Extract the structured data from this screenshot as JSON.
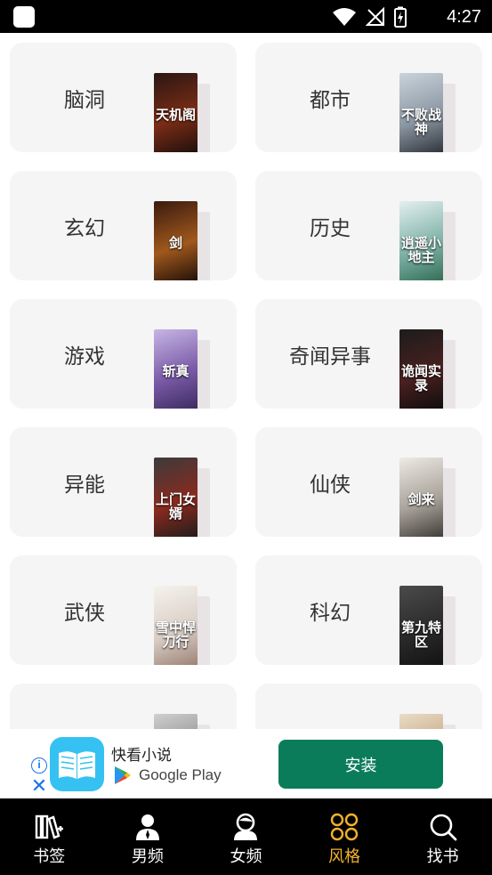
{
  "status_bar": {
    "time": "4:27"
  },
  "categories": [
    {
      "label": "脑洞",
      "cover_title": "天机阁",
      "cover_colors": [
        "#2a1712",
        "#7b2c16",
        "#1a0f0c"
      ]
    },
    {
      "label": "都市",
      "cover_title": "不败战神",
      "cover_colors": [
        "#c9d3db",
        "#8b97a3",
        "#2b2f35"
      ]
    },
    {
      "label": "玄幻",
      "cover_title": "剑",
      "cover_colors": [
        "#3a1a10",
        "#a0581c",
        "#1b0d08"
      ]
    },
    {
      "label": "历史",
      "cover_title": "逍遥小地主",
      "cover_colors": [
        "#e4eef0",
        "#7fb3a8",
        "#2f6b52"
      ]
    },
    {
      "label": "游戏",
      "cover_title": "斩真",
      "cover_colors": [
        "#c7b6e4",
        "#7a5aa8",
        "#3a2a5c"
      ]
    },
    {
      "label": "奇闻异事",
      "cover_title": "诡闻实录",
      "cover_colors": [
        "#1c1c1c",
        "#4a2020",
        "#0c0c0c"
      ]
    },
    {
      "label": "异能",
      "cover_title": "上门女婿",
      "cover_colors": [
        "#3b3b3b",
        "#8a2a1e",
        "#1c1c1c"
      ]
    },
    {
      "label": "仙侠",
      "cover_title": "剑来",
      "cover_colors": [
        "#eeeae4",
        "#a8a29a",
        "#3b3733"
      ]
    },
    {
      "label": "武侠",
      "cover_title": "雪中悍刀行",
      "cover_colors": [
        "#f6f2ee",
        "#d9cfc6",
        "#9a7e72"
      ]
    },
    {
      "label": "科幻",
      "cover_title": "第九特区",
      "cover_colors": [
        "#4b4b4b",
        "#2a2a2a",
        "#121212"
      ]
    },
    {
      "label": "",
      "cover_title": "",
      "cover_colors": [
        "#cfcfcf",
        "#8a8a8a",
        "#3a3a3a"
      ]
    },
    {
      "label": "",
      "cover_title": "",
      "cover_colors": [
        "#e9dcc8",
        "#c4a27a",
        "#7a5a3a"
      ]
    }
  ],
  "ad": {
    "app_name": "快看小说",
    "store_name": "Google Play",
    "install_label": "安装",
    "install_color": "#0a7c5a",
    "info_icon": "i",
    "close_icon": "✕"
  },
  "bottom_nav": [
    {
      "label": "书签",
      "icon": "bookshelf-icon",
      "active": false
    },
    {
      "label": "男频",
      "icon": "male-reader-icon",
      "active": false
    },
    {
      "label": "女频",
      "icon": "female-reader-icon",
      "active": false
    },
    {
      "label": "风格",
      "icon": "style-grid-icon",
      "active": true
    },
    {
      "label": "找书",
      "icon": "search-icon",
      "active": false
    }
  ],
  "colors": {
    "active_nav": "#f3b12d",
    "card_bg": "#f5f5f5"
  }
}
